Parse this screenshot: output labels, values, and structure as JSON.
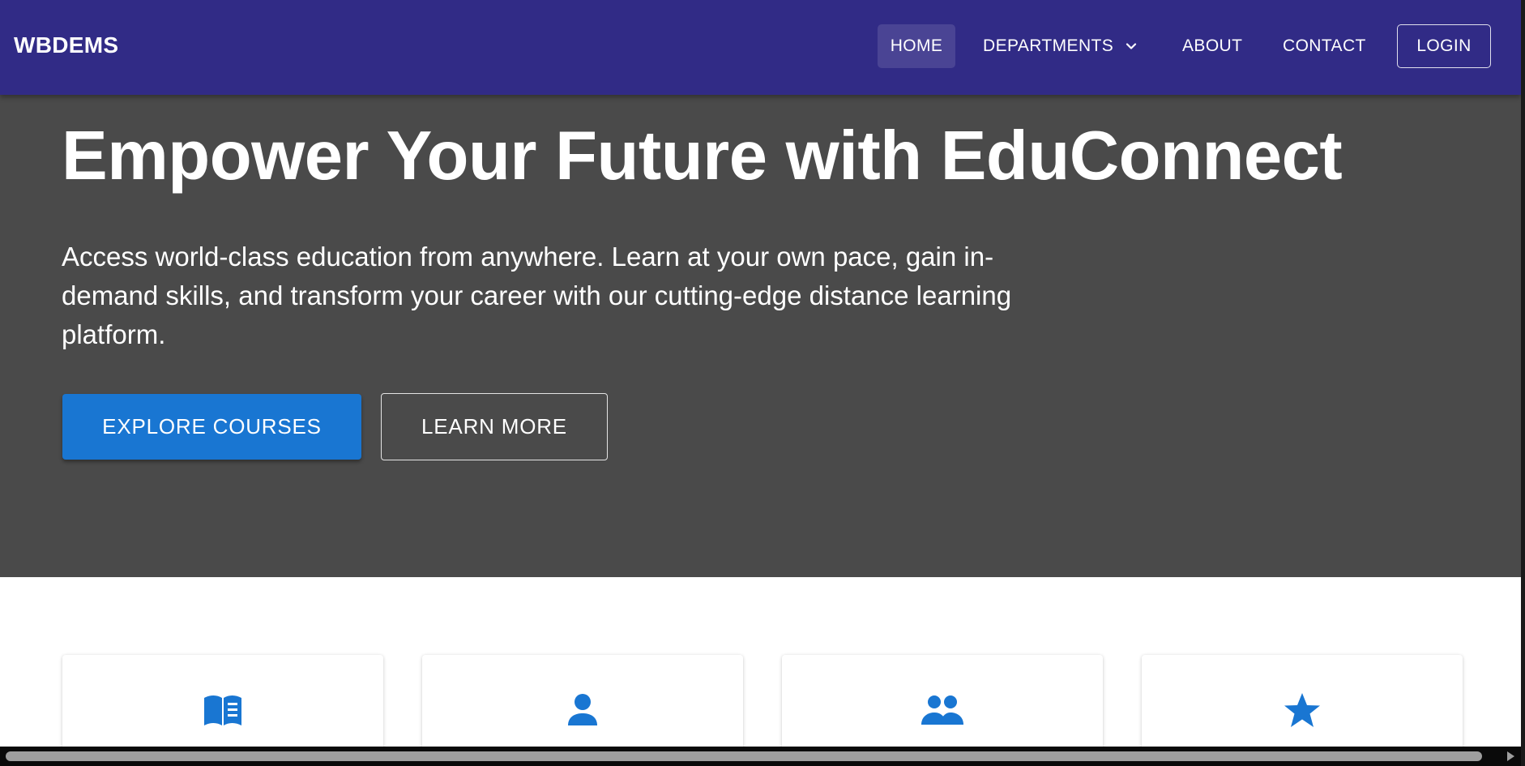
{
  "navbar": {
    "brand": "WBDEMS",
    "items": [
      {
        "label": "HOME",
        "active": true
      },
      {
        "label": "DEPARTMENTS",
        "has_dropdown": true
      },
      {
        "label": "ABOUT"
      },
      {
        "label": "CONTACT"
      }
    ],
    "login_label": "LOGIN",
    "background_color": "#312b86"
  },
  "hero": {
    "title": "Empower Your Future with EduConnect",
    "subtitle": "Access world-class education from anywhere. Learn at your own pace, gain in-demand skills, and transform your career with our cutting-edge distance learning platform.",
    "primary_button": "EXPLORE COURSES",
    "secondary_button": "LEARN MORE",
    "background_color": "#4a4a4a",
    "primary_color": "#1976d2"
  },
  "features": {
    "cards": [
      {
        "icon": "menu-book-icon"
      },
      {
        "icon": "person-icon"
      },
      {
        "icon": "people-icon"
      },
      {
        "icon": "star-icon"
      }
    ],
    "icon_color": "#1976d2"
  }
}
